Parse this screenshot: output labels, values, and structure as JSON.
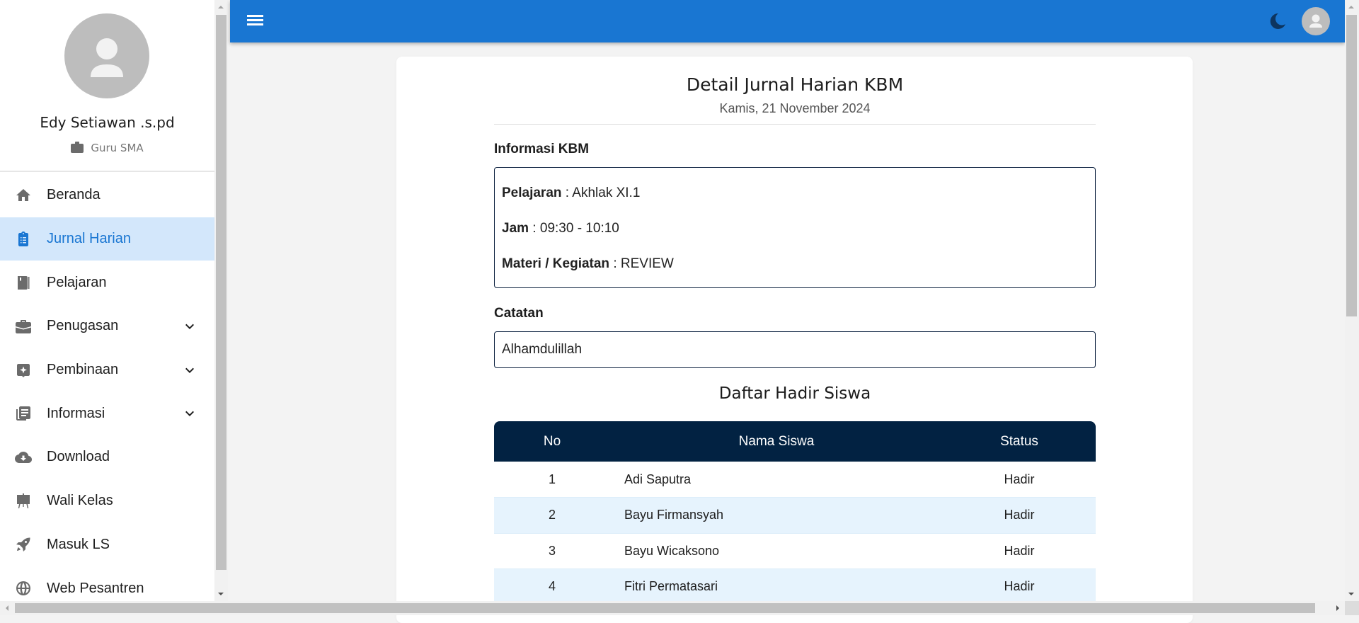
{
  "sidebar": {
    "profile": {
      "name": "Edy Setiawan .s.pd",
      "role": "Guru SMA",
      "avatar_icon": "person-icon",
      "role_icon": "briefcase-icon"
    },
    "items": [
      {
        "label": "Beranda",
        "icon": "home-icon",
        "expandable": false,
        "active": false
      },
      {
        "label": "Jurnal Harian",
        "icon": "clipboard-list-icon",
        "expandable": false,
        "active": true
      },
      {
        "label": "Pelajaran",
        "icon": "book-icon",
        "expandable": false,
        "active": false
      },
      {
        "label": "Penugasan",
        "icon": "briefcase-icon",
        "expandable": true,
        "active": false
      },
      {
        "label": "Pembinaan",
        "icon": "sparkle-badge-icon",
        "expandable": true,
        "active": false
      },
      {
        "label": "Informasi",
        "icon": "article-icon",
        "expandable": true,
        "active": false
      },
      {
        "label": "Download",
        "icon": "cloud-download-icon",
        "expandable": false,
        "active": false
      },
      {
        "label": "Wali Kelas",
        "icon": "easel-icon",
        "expandable": false,
        "active": false
      },
      {
        "label": "Masuk LS",
        "icon": "rocket-icon",
        "expandable": false,
        "active": false
      },
      {
        "label": "Web Pesantren",
        "icon": "globe-icon",
        "expandable": false,
        "active": false
      }
    ]
  },
  "topbar": {
    "menu_icon": "hamburger-menu-icon",
    "theme_icon": "moon-icon",
    "account_icon": "person-icon",
    "color": "#1976D2"
  },
  "page": {
    "title": "Detail Jurnal Harian KBM",
    "date": "Kamis, 21 November 2024",
    "info_section_label": "Informasi KBM",
    "info": {
      "subject_label": "Pelajaran",
      "subject_value": "Akhlak XI.1",
      "time_label": "Jam",
      "time_value": "09:30 - 10:10",
      "material_label": "Materi / Kegiatan",
      "material_value": "REVIEW"
    },
    "notes_label": "Catatan",
    "notes_value": "Alhamdulillah",
    "attendance": {
      "title": "Daftar Hadir Siswa",
      "columns": [
        "No",
        "Nama Siswa",
        "Status"
      ],
      "rows": [
        {
          "no": "1",
          "name": "Adi Saputra",
          "status": "Hadir"
        },
        {
          "no": "2",
          "name": "Bayu Firmansyah",
          "status": "Hadir"
        },
        {
          "no": "3",
          "name": "Bayu Wicaksono",
          "status": "Hadir"
        },
        {
          "no": "4",
          "name": "Fitri Permatasari",
          "status": "Hadir"
        }
      ],
      "header_color": "#022242",
      "stripe_color": "#E6F3FD"
    }
  }
}
